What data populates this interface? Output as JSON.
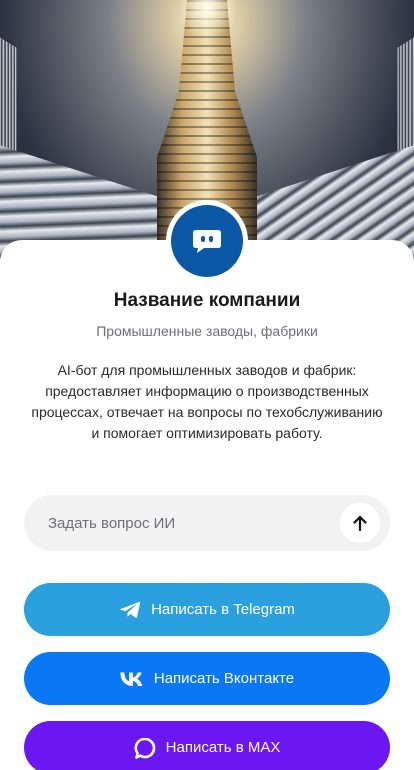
{
  "hero": {
    "image_icon": "factory-hall-image"
  },
  "profile": {
    "avatar_icon": "chat-bot-icon",
    "avatar_color": "#0b58a6",
    "company_name": "Название компании",
    "category": "Промышленные заводы, фабрики",
    "description": "AI-бот для промышленных заводов и фабрик: предоставляет информацию о производственных процессах, отвечает на вопросы по техобслуживанию и помогает оптимизировать работу."
  },
  "ask": {
    "placeholder": "Задать вопрос ИИ",
    "value": "",
    "send_icon": "arrow-up-icon"
  },
  "buttons": [
    {
      "label": "Написать в Telegram",
      "icon": "telegram-icon",
      "color": "#2aa1de"
    },
    {
      "label": "Написать Вконтакте",
      "icon": "vk-icon",
      "color": "#0a77f5"
    },
    {
      "label": "Написать в MAX",
      "icon": "max-icon",
      "color": "#6a17f2"
    }
  ]
}
